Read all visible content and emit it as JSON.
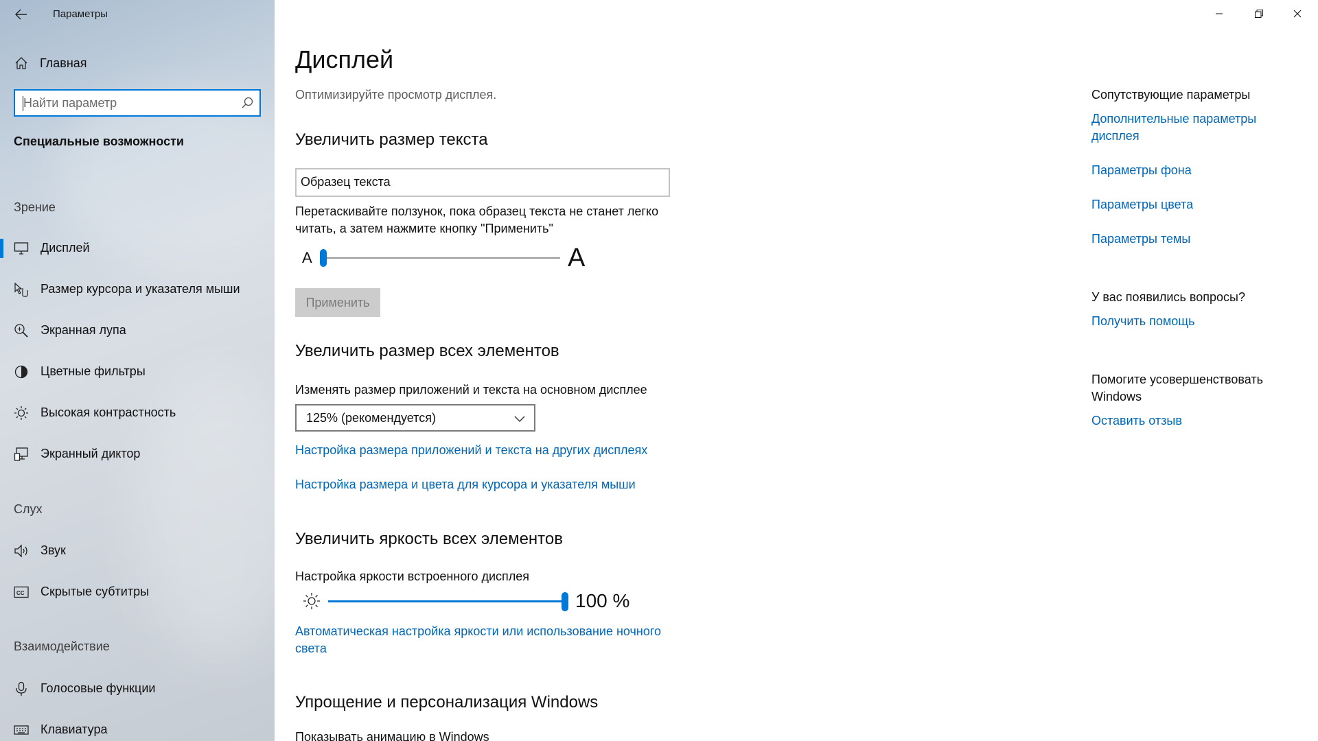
{
  "window": {
    "app_title": "Параметры",
    "controls": {
      "minimize": "minimize-icon",
      "maximize": "restore-icon",
      "close": "close-icon"
    }
  },
  "sidebar": {
    "home_label": "Главная",
    "search_placeholder": "Найти параметр",
    "section_title": "Специальные возможности",
    "groups": [
      {
        "label": "Зрение",
        "items": [
          {
            "label": "Дисплей",
            "icon": "display-icon",
            "active": true
          },
          {
            "label": "Размер курсора и указателя мыши",
            "icon": "cursor-icon"
          },
          {
            "label": "Экранная лупа",
            "icon": "magnifier-icon"
          },
          {
            "label": "Цветные фильтры",
            "icon": "color-filter-icon"
          },
          {
            "label": "Высокая контрастность",
            "icon": "contrast-icon"
          },
          {
            "label": "Экранный диктор",
            "icon": "narrator-icon"
          }
        ]
      },
      {
        "label": "Слух",
        "items": [
          {
            "label": "Звук",
            "icon": "speaker-icon"
          },
          {
            "label": "Скрытые субтитры",
            "icon": "captions-icon"
          }
        ]
      },
      {
        "label": "Взаимодействие",
        "items": [
          {
            "label": "Голосовые функции",
            "icon": "microphone-icon"
          },
          {
            "label": "Клавиатура",
            "icon": "keyboard-icon"
          }
        ]
      }
    ]
  },
  "main": {
    "title": "Дисплей",
    "subtitle": "Оптимизируйте просмотр дисплея.",
    "text_size": {
      "heading": "Увеличить размер текста",
      "sample": "Образец текста",
      "description": "Перетаскивайте ползунок, пока образец текста не станет легко читать, а затем нажмите кнопку \"Применить\"",
      "slider_small_label": "A",
      "slider_large_label": "A",
      "slider_value": 0,
      "apply_label": "Применить"
    },
    "scale": {
      "heading": "Увеличить размер всех элементов",
      "label": "Изменять размер приложений и текста на основном дисплее",
      "selected": "125% (рекомендуется)",
      "link_other_displays": "Настройка размера приложений и текста на других дисплеях",
      "link_cursor": "Настройка размера и цвета для курсора и указателя мыши"
    },
    "brightness": {
      "heading": "Увеличить яркость всех элементов",
      "label": "Настройка яркости встроенного дисплея",
      "value": 100,
      "value_text": "100 %",
      "link_auto": "Автоматическая настройка яркости или использование ночного света"
    },
    "personalize": {
      "heading": "Упрощение и персонализация Windows",
      "cutoff_text": "Показывать анимацию в Windows"
    }
  },
  "related": {
    "heading": "Сопутствующие параметры",
    "links": [
      "Дополнительные параметры дисплея",
      "Параметры фона",
      "Параметры цвета",
      "Параметры темы"
    ],
    "questions_heading": "У вас появились вопросы?",
    "help_link": "Получить помощь",
    "improve_heading": "Помогите усовершенствовать Windows",
    "feedback_link": "Оставить отзыв"
  },
  "colors": {
    "accent": "#0078d7",
    "link": "#0067b8",
    "disabled_button": "#cccccc"
  }
}
